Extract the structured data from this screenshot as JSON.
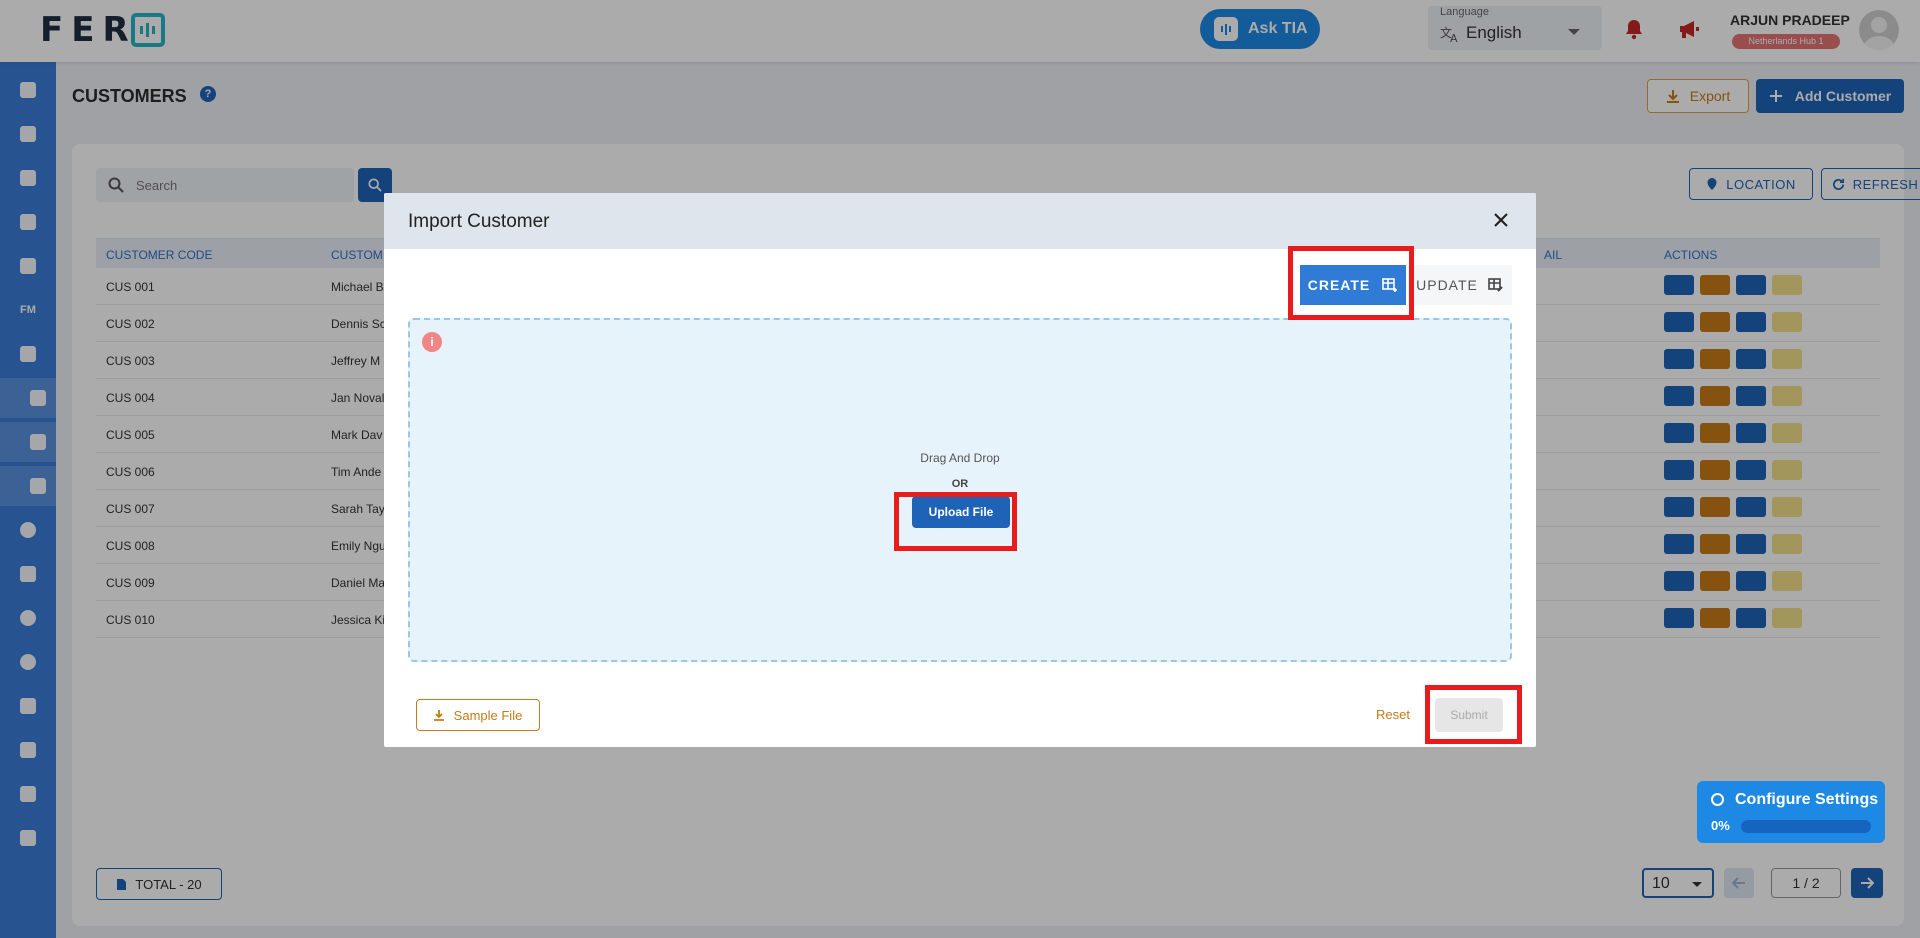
{
  "topbar": {
    "logo_text": "FER",
    "ask_tia": "Ask TIA",
    "language_label": "Language",
    "language_value": "English",
    "user_name": "ARJUN PRADEEP",
    "hub": "Netherlands Hub 1"
  },
  "sidebar": {
    "fm_label": "FM",
    "items": [
      "dashboard-icon",
      "chart-icon",
      "calendar-icon",
      "truck-icon",
      "archive-icon",
      "fm",
      "people-icon",
      "person-icon",
      "location-icon",
      "location-check-icon",
      "info-icon",
      "group-icon",
      "palette-icon",
      "gear-icon",
      "edit-icon",
      "briefcase-icon",
      "user-icon",
      "download-icon"
    ]
  },
  "page": {
    "title": "CUSTOMERS",
    "help": "?",
    "export_label": "Export",
    "add_label": "Add Customer"
  },
  "toolbar": {
    "search_placeholder": "Search",
    "location_label": "LOCATION",
    "refresh_label": "REFRESH"
  },
  "table": {
    "headers": [
      "CUSTOMER CODE",
      "CUSTOM",
      "AIL",
      "ACTIONS"
    ],
    "rows": [
      {
        "code": "CUS 001",
        "name": "Michael B"
      },
      {
        "code": "CUS 002",
        "name": "Dennis Sc"
      },
      {
        "code": "CUS 003",
        "name": "Jeffrey M"
      },
      {
        "code": "CUS 004",
        "name": "Jan Noval"
      },
      {
        "code": "CUS 005",
        "name": "Mark Dav"
      },
      {
        "code": "CUS 006",
        "name": "Tim Ande"
      },
      {
        "code": "CUS 007",
        "name": "Sarah Tay"
      },
      {
        "code": "CUS 008",
        "name": "Emily Ngu"
      },
      {
        "code": "CUS 009",
        "name": "Daniel Ma"
      },
      {
        "code": "CUS 010",
        "name": "Jessica Ki"
      }
    ]
  },
  "footer": {
    "total": "TOTAL  - 20",
    "page_size": "10",
    "page_indicator": "1  /  2"
  },
  "modal": {
    "title": "Import Customer",
    "create_tab": "CREATE",
    "update_tab": "UPDATE",
    "drag_text": "Drag And Drop",
    "or_text": "OR",
    "upload_label": "Upload File",
    "sample_label": "Sample File",
    "reset_label": "Reset",
    "submit_label": "Submit",
    "info_icon": "i"
  },
  "configure": {
    "title": "Configure Settings",
    "percent": "0%",
    "progress": 0
  },
  "colors": {
    "primary": "#1e63b8",
    "sidebar": "#3b7dd8",
    "accent_orange": "#c67b18",
    "highlight_red": "#e81c1c"
  }
}
